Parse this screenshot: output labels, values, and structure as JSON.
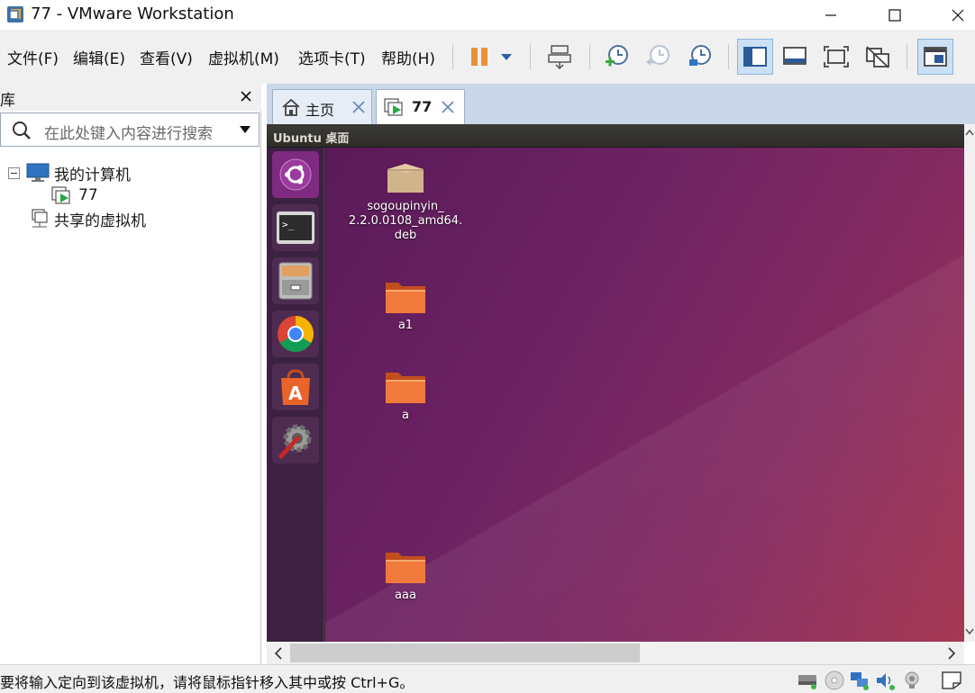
{
  "window": {
    "title": "77 - VMware Workstation"
  },
  "menu": {
    "items": [
      "文件(F)",
      "编辑(E)",
      "查看(V)",
      "虚拟机(M)",
      "选项卡(T)",
      "帮助(H)"
    ]
  },
  "toolbar": {
    "buttons": [
      "pause-vm",
      "pause-dropdown",
      "send-ctrl-alt-del",
      "take-snapshot",
      "revert-snapshot",
      "snapshot-manager",
      "show-library",
      "fit-guest",
      "full-screen",
      "unity",
      "console-view"
    ],
    "active": [
      "show-library",
      "console-view"
    ]
  },
  "library": {
    "title": "库",
    "search_placeholder": "在此处键入内容进行搜索",
    "tree": {
      "my_computer": "我的计算机",
      "vm_name": "77",
      "shared": "共享的虚拟机"
    }
  },
  "tabs": {
    "home": "主页",
    "vm": "77"
  },
  "vm": {
    "guest_title": "Ubuntu 桌面",
    "launcher": [
      "ubuntu-dash",
      "terminal",
      "files",
      "chrome",
      "software-center",
      "system-settings"
    ],
    "desktop_icons": [
      {
        "label": "sogoupinyin_\n2.2.0.0108_amd64.\ndeb",
        "kind": "package"
      },
      {
        "label": "a1",
        "kind": "folder"
      },
      {
        "label": "a",
        "kind": "folder"
      },
      {
        "label": "aaa",
        "kind": "folder"
      }
    ]
  },
  "status": {
    "message": "要将输入定向到该虚拟机，请将鼠标指针移入其中或按 Ctrl+G。",
    "devices": [
      "hard-disk",
      "cd-dvd",
      "network-adapter",
      "sound-card",
      "usb-device",
      "message-log"
    ]
  },
  "colors": {
    "titlebar": "#ffffff",
    "chrome_gray": "#f0f0f0",
    "tabstrip": "#cad7e8",
    "launcher": "#3c2140",
    "desktop_purple": "#6e2363",
    "desktop_red": "#a4344f",
    "folder_orange": "#e8642a"
  }
}
